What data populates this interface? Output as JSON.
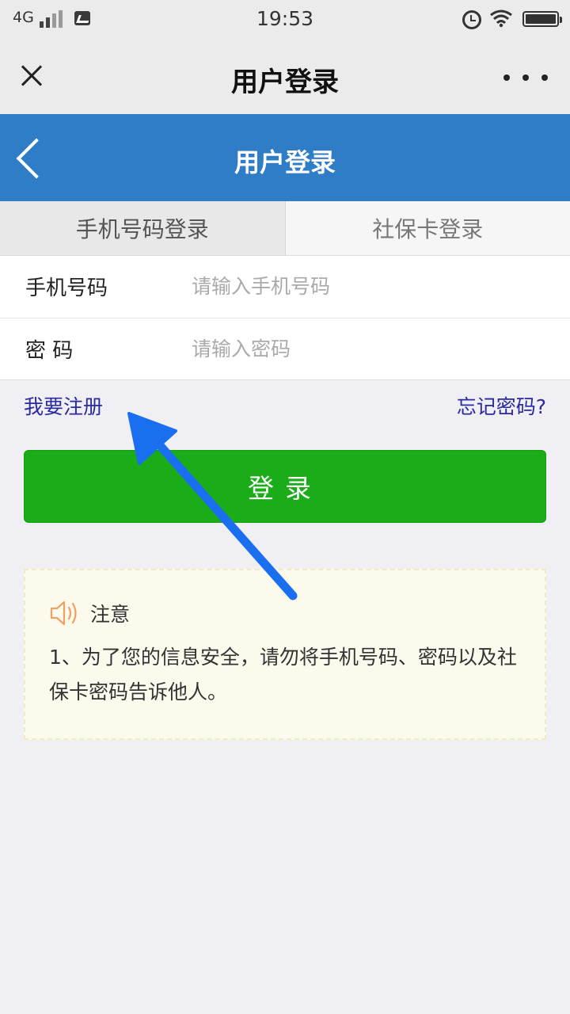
{
  "status_bar": {
    "network": "4G",
    "time": "19:53",
    "icons": [
      "signal-icon",
      "photo-icon",
      "alarm-icon",
      "wifi-icon",
      "battery-icon"
    ]
  },
  "wechat_bar": {
    "title": "用户登录",
    "close_icon": "close-icon",
    "more_icon": "more-icon"
  },
  "header": {
    "title": "用户登录",
    "back_icon": "back-icon",
    "background": "#2f7cc7"
  },
  "tabs": [
    {
      "label": "手机号码登录",
      "active": true
    },
    {
      "label": "社保卡登录",
      "active": false
    }
  ],
  "form": {
    "phone": {
      "label": "手机号码",
      "placeholder": "请输入手机号码",
      "value": ""
    },
    "password": {
      "label": "密 码",
      "placeholder": "请输入密码",
      "value": ""
    }
  },
  "links": {
    "register": "我要注册",
    "forgot": "忘记密码?"
  },
  "login_button": {
    "label": "登录",
    "color": "#1aad19"
  },
  "notice": {
    "icon": "speaker-icon",
    "title": "注意",
    "text": "1、为了您的信息安全，请勿将手机号码、密码以及社保卡密码告诉他人。"
  },
  "annotation": {
    "arrow_color": "#1a6ff0",
    "points_to": "我要注册"
  }
}
